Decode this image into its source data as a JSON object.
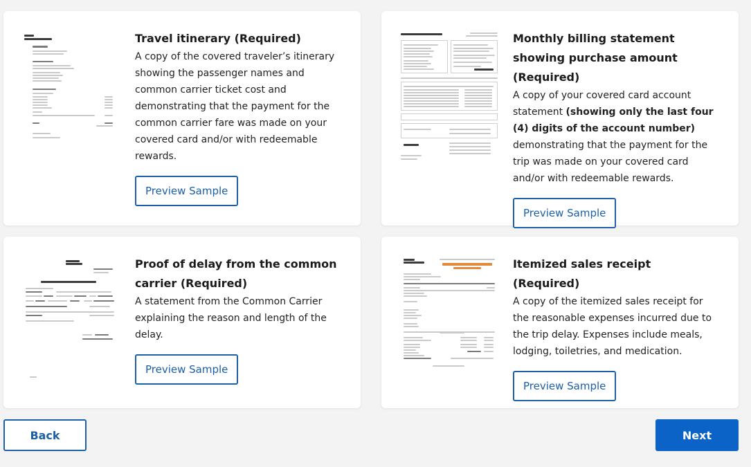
{
  "cards": [
    {
      "title": "Travel itinerary (Required)",
      "desc": "A copy of the covered traveler’s itinerary showing the passenger names and common carrier ticket cost and demonstrating that the payment for the common carrier fare was made on your covered card and/or with redeemable rewards.",
      "button": "Preview Sample",
      "thumb_icon": "travel-receipt-thumbnail-icon"
    },
    {
      "title": "Monthly billing statement showing purchase amount (Required)",
      "desc_parts": [
        "A copy of your covered card account statement ",
        "(showing only the last four (4) digits of the account number)",
        " demonstrating that the payment for the trip was made on your covered card and/or with redeemable rewards."
      ],
      "button": "Preview Sample",
      "thumb_icon": "credit-card-statement-thumbnail-icon"
    },
    {
      "title": "Proof of delay from the common carrier (Required)",
      "desc": "A statement from the Common Carrier explaining the reason and length of the delay.",
      "button": "Preview Sample",
      "thumb_icon": "delay-letter-thumbnail-icon"
    },
    {
      "title": "Itemized sales receipt (Required)",
      "desc": "A copy of the itemized sales receipt for the reasonable expenses incurred due to the trip delay. Expenses include meals, lodging, toiletries, and medication.",
      "button": "Preview Sample",
      "thumb_icon": "sales-receipt-thumbnail-icon"
    }
  ],
  "nav": {
    "back": "Back",
    "next": "Next"
  },
  "colors": {
    "accent": "#1a5fa8",
    "primary_button": "#0b63c7",
    "background": "#f3f3f3"
  }
}
